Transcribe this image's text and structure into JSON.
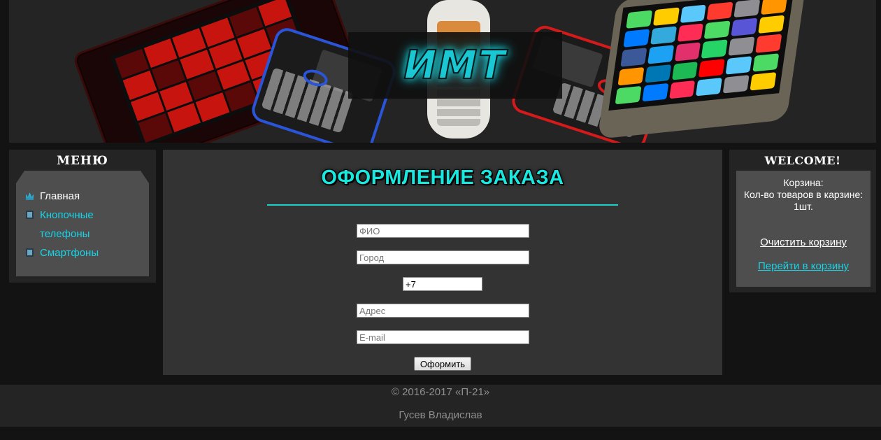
{
  "header": {
    "logo": "ИМТ",
    "accent_color": "#19c8d2"
  },
  "menu": {
    "title": "МЕНЮ",
    "items": [
      {
        "label": "Главная",
        "icon": "crown-icon",
        "active": true
      },
      {
        "label": "Кнопочные телефоны",
        "icon": "phone-icon",
        "active": false
      },
      {
        "label": "Смартфоны",
        "icon": "phone-icon",
        "active": false
      }
    ]
  },
  "order": {
    "title": "ОФОРМЛЕНИЕ ЗАКАЗА",
    "fields": {
      "fio_placeholder": "ФИО",
      "city_placeholder": "Город",
      "phone_value": "+7",
      "address_placeholder": "Адрес",
      "email_placeholder": "E-mail"
    },
    "submit_label": "Оформить"
  },
  "welcome": {
    "title": "WELCOME!",
    "cart_label": "Корзина:",
    "cart_count_label": "Кол-во товаров в карзине:",
    "cart_count": "1шт.",
    "clear_cart": "Очистить корзину",
    "go_to_cart": "Перейти в корзину"
  },
  "footer": {
    "copyright": "© 2016-2017 «П-21»",
    "author": "Гусев Владислав"
  }
}
